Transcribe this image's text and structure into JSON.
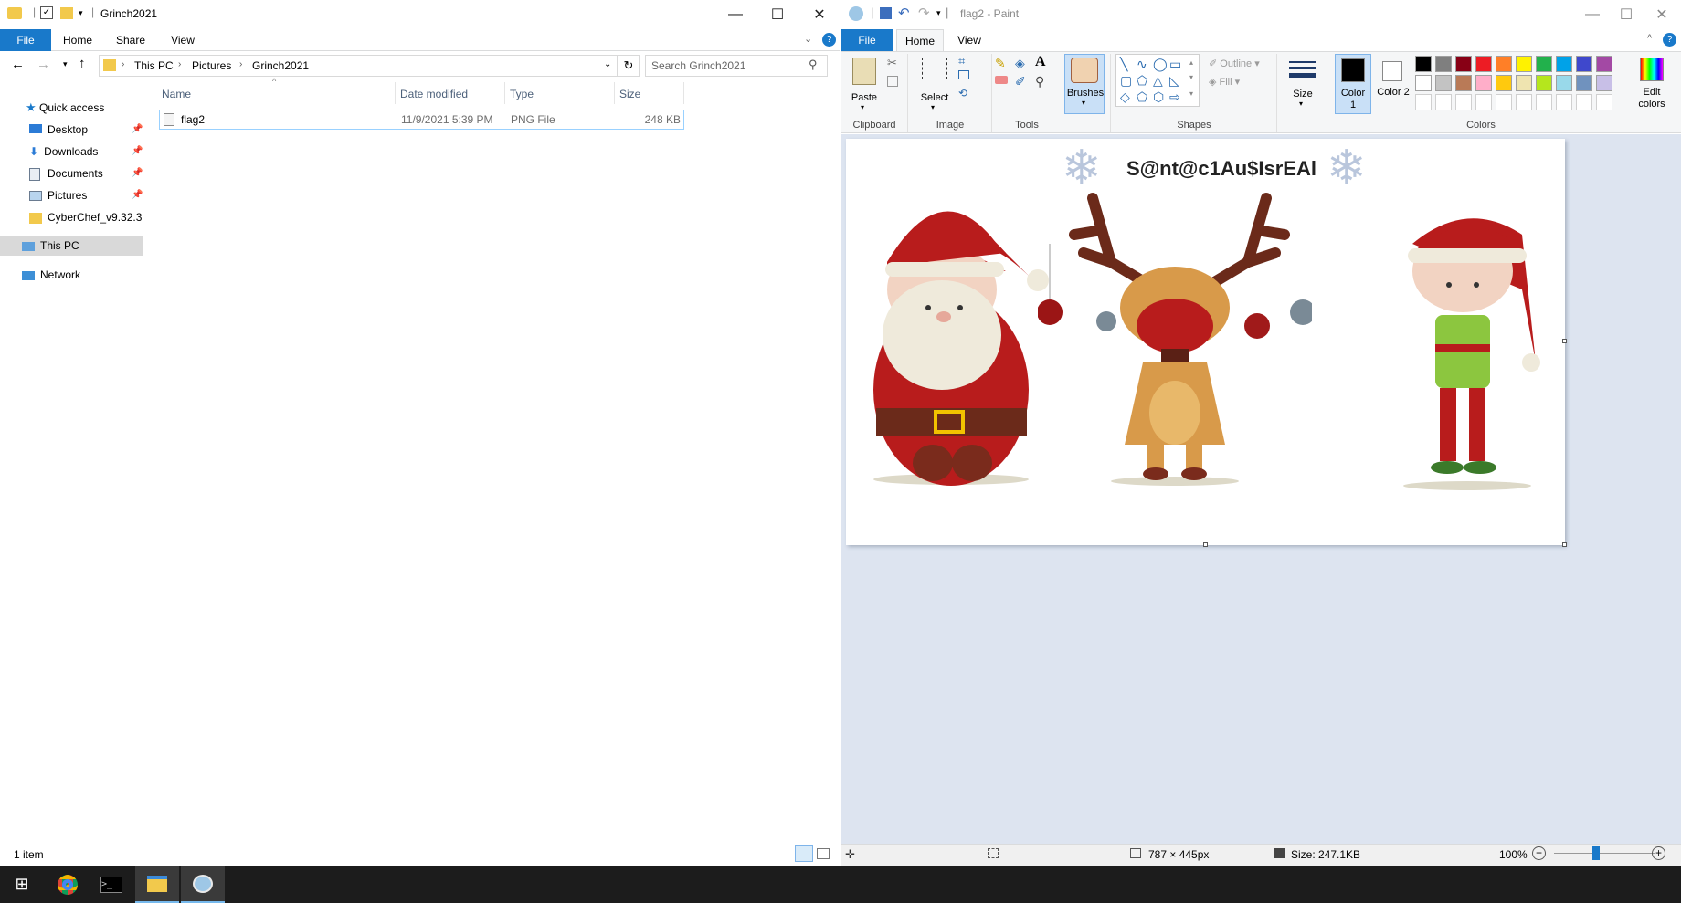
{
  "explorer": {
    "title": "Grinch2021",
    "tabs": [
      "File",
      "Home",
      "Share",
      "View"
    ],
    "breadcrumb": [
      "This PC",
      "Pictures",
      "Grinch2021"
    ],
    "search_placeholder": "Search Grinch2021",
    "sidebar": {
      "quick_access": "Quick access",
      "items": [
        "Desktop",
        "Downloads",
        "Documents",
        "Pictures",
        "CyberChef_v9.32.3"
      ],
      "this_pc": "This PC",
      "network": "Network"
    },
    "columns": [
      "Name",
      "Date modified",
      "Type",
      "Size"
    ],
    "files": [
      {
        "name": "flag2",
        "date": "11/9/2021 5:39 PM",
        "type": "PNG File",
        "size": "248 KB"
      }
    ],
    "status": "1 item"
  },
  "paint": {
    "title": "flag2 - Paint",
    "tabs": [
      "File",
      "Home",
      "View"
    ],
    "groups": {
      "clipboard": "Clipboard",
      "image": "Image",
      "tools": "Tools",
      "shapes": "Shapes",
      "colors": "Colors"
    },
    "buttons": {
      "paste": "Paste",
      "select": "Select",
      "brushes": "Brushes",
      "outline": "Outline",
      "fill": "Fill",
      "size": "Size",
      "color1": "Color 1",
      "color2": "Color 2",
      "edit_colors": "Edit colors"
    },
    "palette_row1": [
      "#000000",
      "#7f7f7f",
      "#880015",
      "#ed1c24",
      "#ff7f27",
      "#fff200",
      "#22b14c",
      "#00a2e8",
      "#3f48cc",
      "#a349a4"
    ],
    "palette_row2": [
      "#ffffff",
      "#c3c3c3",
      "#b97a57",
      "#ffaec9",
      "#ffc90e",
      "#efe4b0",
      "#b5e61d",
      "#99d9ea",
      "#7092be",
      "#c8bfe7"
    ],
    "canvas_text": "S@nt@c1Au$IsrEAl",
    "status": {
      "dimensions": "787 × 445px",
      "size": "Size: 247.1KB",
      "zoom": "100%"
    }
  }
}
